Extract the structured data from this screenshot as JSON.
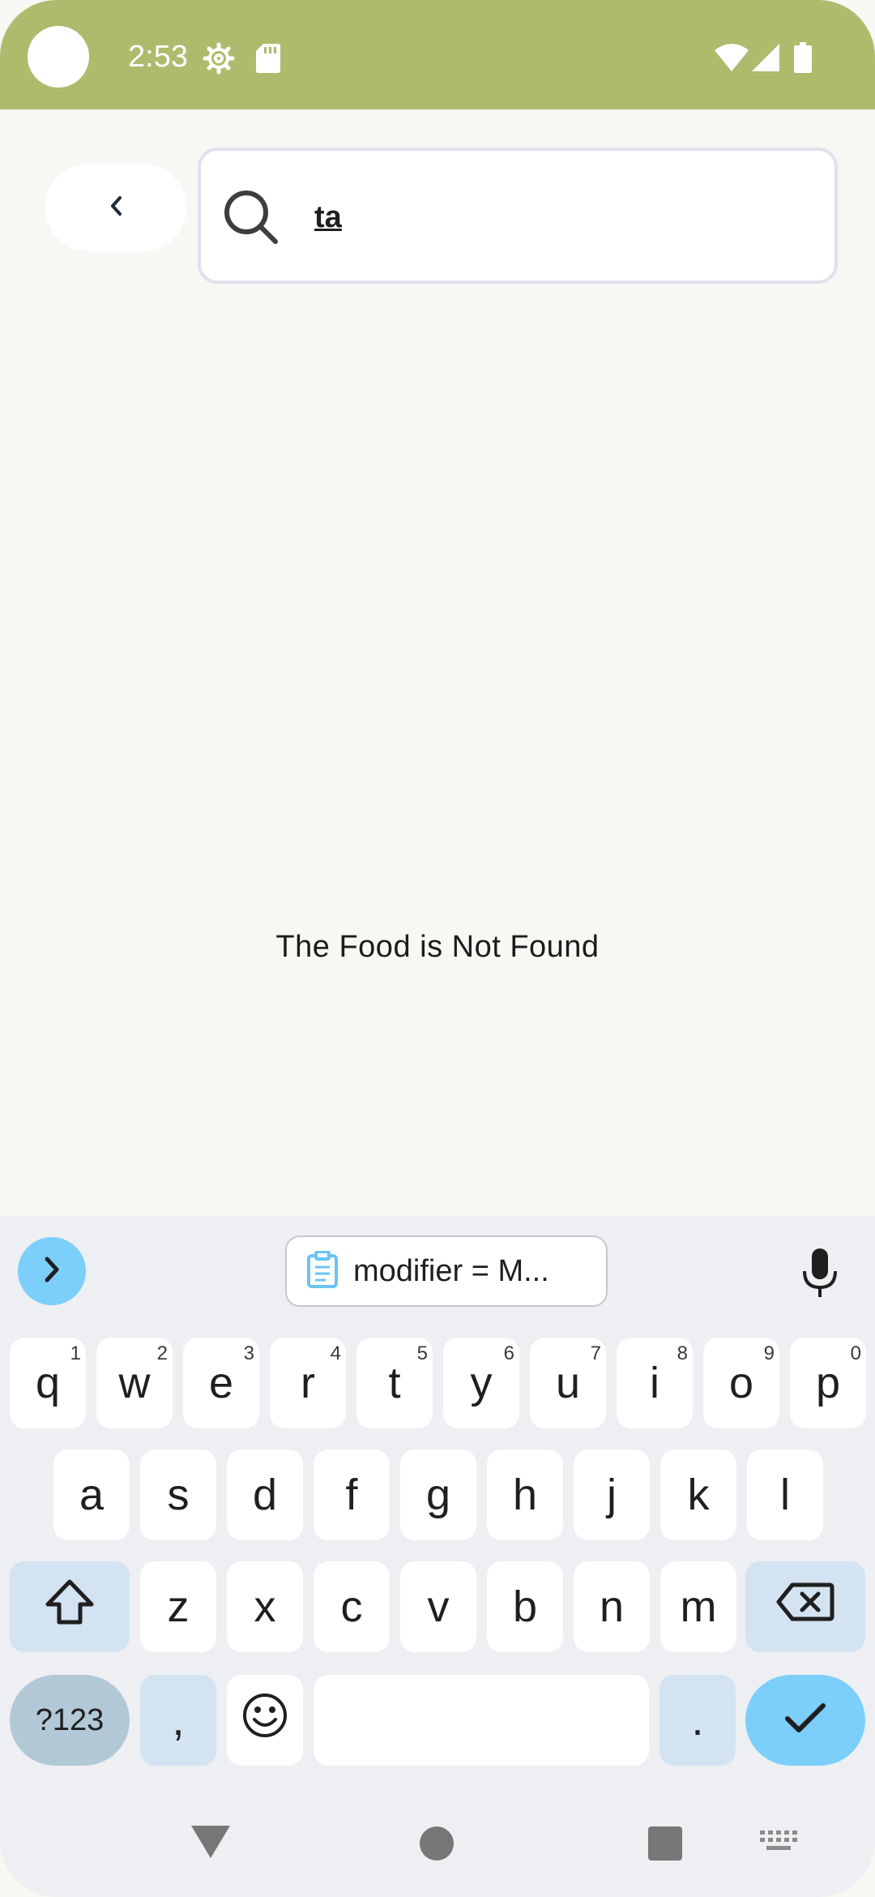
{
  "status_bar": {
    "time": "2:53",
    "icons": [
      "settings-gear-icon",
      "sd-card-icon",
      "wifi-icon",
      "cell-signal-icon",
      "battery-icon"
    ],
    "background": "#adbb6d"
  },
  "header": {
    "back_icon": "chevron-left-icon",
    "search": {
      "icon": "search-icon",
      "value": "ta"
    }
  },
  "main": {
    "empty_message": "The Food is Not Found"
  },
  "keyboard": {
    "clipboard_suggestion": "modifier = M...",
    "rows": [
      [
        {
          "label": "q",
          "hint": "1"
        },
        {
          "label": "w",
          "hint": "2"
        },
        {
          "label": "e",
          "hint": "3"
        },
        {
          "label": "r",
          "hint": "4"
        },
        {
          "label": "t",
          "hint": "5"
        },
        {
          "label": "y",
          "hint": "6"
        },
        {
          "label": "u",
          "hint": "7"
        },
        {
          "label": "i",
          "hint": "8"
        },
        {
          "label": "o",
          "hint": "9"
        },
        {
          "label": "p",
          "hint": "0"
        }
      ],
      [
        {
          "label": "a"
        },
        {
          "label": "s"
        },
        {
          "label": "d"
        },
        {
          "label": "f"
        },
        {
          "label": "g"
        },
        {
          "label": "h"
        },
        {
          "label": "j"
        },
        {
          "label": "k"
        },
        {
          "label": "l"
        }
      ],
      [
        {
          "label": "z"
        },
        {
          "label": "x"
        },
        {
          "label": "c"
        },
        {
          "label": "v"
        },
        {
          "label": "b"
        },
        {
          "label": "n"
        },
        {
          "label": "m"
        }
      ]
    ],
    "symbols_label": "?123",
    "comma_label": ",",
    "period_label": ".",
    "accent_color": "#7ccffb"
  },
  "nav_bar": {
    "icons": [
      "nav-back-icon",
      "nav-home-icon",
      "nav-recents-icon",
      "keyboard-switch-icon"
    ]
  }
}
